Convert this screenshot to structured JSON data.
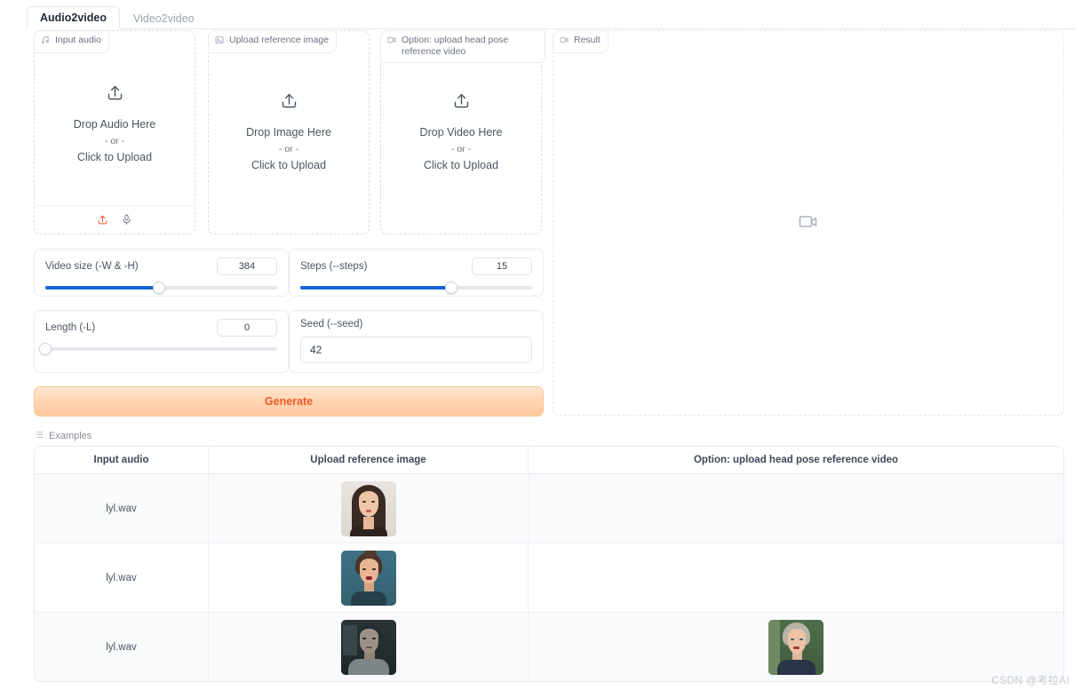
{
  "tabs": [
    {
      "label": "Audio2video",
      "active": true
    },
    {
      "label": "Video2video",
      "active": false
    }
  ],
  "panels": {
    "audio": {
      "label": "Input audio",
      "icon": "music-note-icon",
      "drop_main": "Drop Audio Here",
      "drop_or": "- or -",
      "drop_click": "Click to Upload",
      "tools": [
        "upload-icon",
        "microphone-icon"
      ]
    },
    "image": {
      "label": "Upload reference image",
      "icon": "image-icon",
      "drop_main": "Drop Image Here",
      "drop_or": "- or -",
      "drop_click": "Click to Upload"
    },
    "video": {
      "label": "Option: upload head pose reference video",
      "icon": "video-camera-icon",
      "drop_main": "Drop Video Here",
      "drop_or": "- or -",
      "drop_click": "Click to Upload"
    },
    "result": {
      "label": "Result",
      "icon": "video-camera-icon",
      "placeholder_icon": "video-camera-icon"
    }
  },
  "controls": {
    "video_size": {
      "label": "Video size (-W & -H)",
      "value": "384",
      "fill_percent": 49
    },
    "steps": {
      "label": "Steps (--steps)",
      "value": "15",
      "fill_percent": 65
    },
    "length": {
      "label": "Length (-L)",
      "value": "0",
      "fill_percent": 0
    },
    "seed": {
      "label": "Seed (--seed)",
      "value": "42"
    }
  },
  "generate": {
    "label": "Generate",
    "color": "#f05a28"
  },
  "examples": {
    "label": "Examples",
    "icon": "list-icon",
    "columns": [
      "Input audio",
      "Upload reference image",
      "Option: upload head pose reference video"
    ],
    "rows": [
      {
        "audio": "lyl.wav",
        "image": "portrait-young-woman-long-dark-hair",
        "video": ""
      },
      {
        "audio": "lyl.wav",
        "image": "portrait-woman-updo-teal-background",
        "video": ""
      },
      {
        "audio": "lyl.wav",
        "image": "portrait-man-dark-desaturated",
        "video": "portrait-older-woman-green-background"
      }
    ]
  },
  "watermark": "CSDN @考拉AI"
}
